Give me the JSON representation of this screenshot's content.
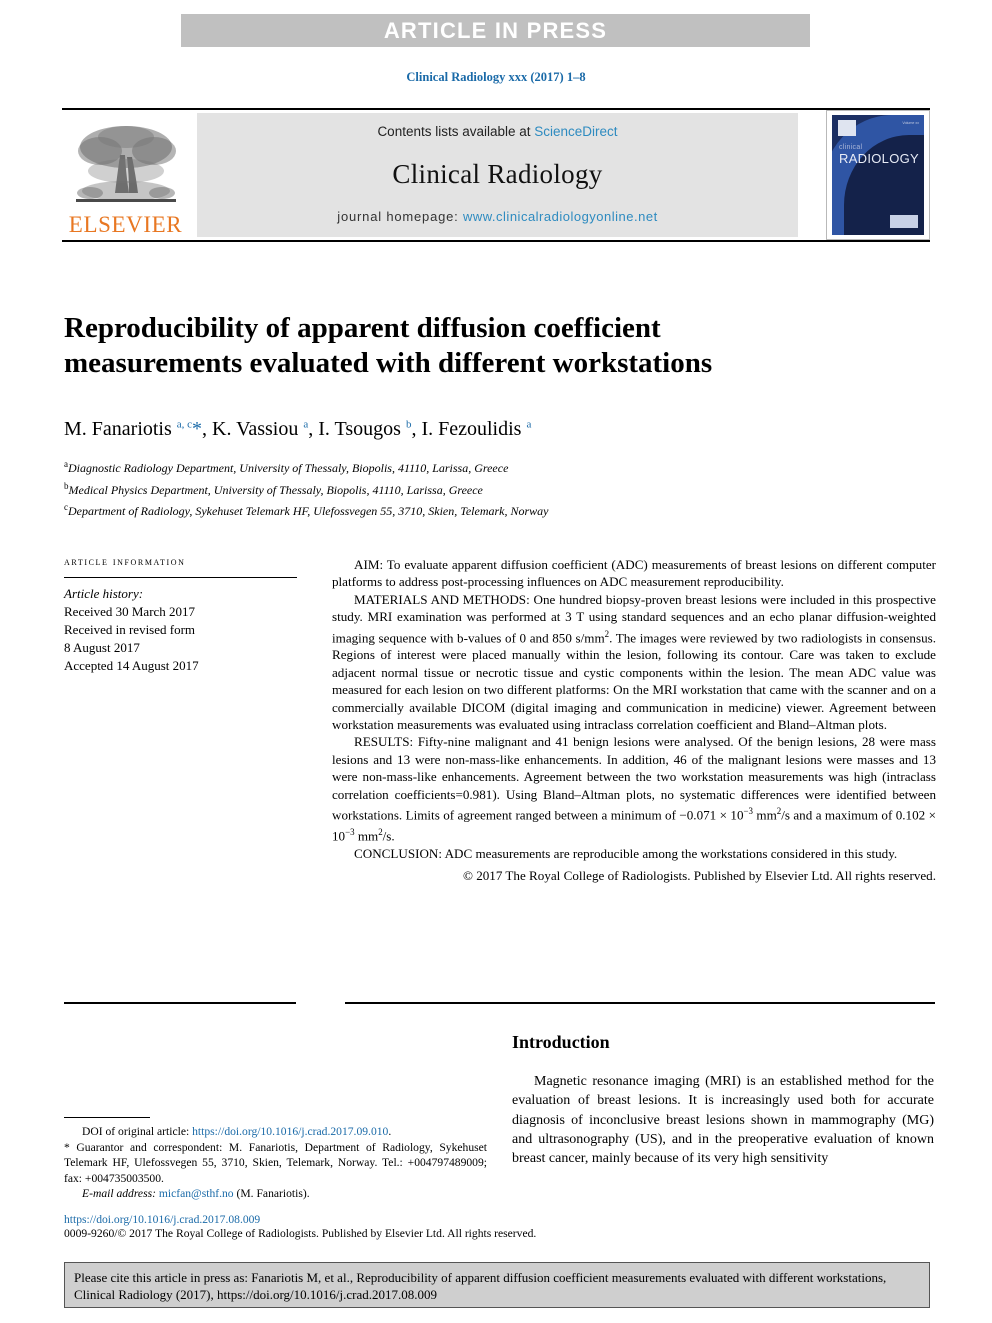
{
  "banner": {
    "text": "ARTICLE IN PRESS"
  },
  "journal_line": "Clinical Radiology xxx (2017) 1–8",
  "masthead": {
    "elsevier_wordmark": "ELSEVIER",
    "contents_prefix": "Contents lists available at ",
    "contents_link": "ScienceDirect",
    "journal_title": "Clinical Radiology",
    "homepage_prefix": "journal homepage: ",
    "homepage_link": "www.clinicalradiologyonline.net",
    "cover": {
      "line1": "clinical",
      "line2": "RADIOLOGY",
      "corner_text": "Volume xx"
    }
  },
  "article": {
    "title": "Reproducibility of apparent diffusion coefficient measurements evaluated with different workstations",
    "authors_html": "M. Fanariotis <sup>a, c</sup><span class=\"star\">*</span>, K. Vassiou <sup>a</sup>, I. Tsougos <sup>b</sup>, I. Fezoulidis <sup>a</sup>",
    "affiliations": [
      {
        "marker": "a",
        "text": "Diagnostic Radiology Department, University of Thessaly, Biopolis, 41110, Larissa, Greece"
      },
      {
        "marker": "b",
        "text": "Medical Physics Department, University of Thessaly, Biopolis, 41110, Larissa, Greece"
      },
      {
        "marker": "c",
        "text": "Department of Radiology, Sykehuset Telemark HF, Ulefossvegen 55, 3710, Skien, Telemark, Norway"
      }
    ]
  },
  "article_info": {
    "heading": "ARTICLE INFORMATION",
    "history_label": "Article history:",
    "history": [
      "Received 30 March 2017",
      "Received in revised form",
      "8 August 2017",
      "Accepted 14 August 2017"
    ]
  },
  "abstract": {
    "aim": "AIM: To evaluate apparent diffusion coefficient (ADC) measurements of breast lesions on different computer platforms to address post-processing influences on ADC measurement reproducibility.",
    "materials_html": "MATERIALS AND METHODS: One hundred biopsy-proven breast lesions were included in this prospective study. MRI examination was performed at 3 T using standard sequences and an echo planar diffusion-weighted imaging sequence with b-values of 0 and 850 s/mm<sup class=\"sup-s\">2</sup>. The images were reviewed by two radiologists in consensus. Regions of interest were placed manually within the lesion, following its contour. Care was taken to exclude adjacent normal tissue or necrotic tissue and cystic components within the lesion. The mean ADC value was measured for each lesion on two different platforms: On the MRI workstation that came with the scanner and on a commercially available DICOM (digital imaging and communication in medicine) viewer. Agreement between workstation measurements was evaluated using intraclass correlation coefficient and Bland–Altman plots.",
    "results_html": "RESULTS: Fifty-nine malignant and 41 benign lesions were analysed. Of the benign lesions, 28 were mass lesions and 13 were non-mass-like enhancements. In addition, 46 of the malignant lesions were masses and 13 were non-mass-like enhancements. Agreement between the two workstation measurements was high (intraclass correlation coefficients=0.981). Using Bland–Altman plots, no systematic differences were identified between workstations. Limits of agreement ranged between a minimum of −0.071 × 10<sup class=\"sup-s\">−3</sup> mm<sup class=\"sup-s\">2</sup>/s and a maximum of 0.102 × 10<sup class=\"sup-s\">−3</sup> mm<sup class=\"sup-s\">2</sup>/s.",
    "conclusion": "CONCLUSION: ADC measurements are reproducible among the workstations considered in this study.",
    "copyright": "© 2017 The Royal College of Radiologists. Published by Elsevier Ltd. All rights reserved."
  },
  "introduction": {
    "heading": "Introduction",
    "paragraph": "Magnetic resonance imaging (MRI) is an established method for the evaluation of breast lesions. It is increasingly used both for accurate diagnosis of inconclusive breast lesions shown in mammography (MG) and ultrasonography (US), and in the preoperative evaluation of known breast cancer, mainly because of its very high sensitivity"
  },
  "footnotes": {
    "doi_original_label": "DOI of original article: ",
    "doi_original_link": "https://doi.org/10.1016/j.crad.2017.09.010",
    "doi_original_suffix": ".",
    "correspondent": "* Guarantor and correspondent: M. Fanariotis, Department of Radiology, Sykehuset Telemark HF, Ulefossvegen 55, 3710, Skien, Telemark, Norway. Tel.: +004797489009; fax: +004735003500.",
    "email_label": "E-mail address: ",
    "email_link": "micfan@sthf.no",
    "email_suffix": " (M. Fanariotis).",
    "doi_line": "https://doi.org/10.1016/j.crad.2017.08.009",
    "issn_line": "0009-9260/© 2017 The Royal College of Radiologists. Published by Elsevier Ltd. All rights reserved."
  },
  "citation_box": {
    "text": "Please cite this article in press as: Fanariotis M, et al., Reproducibility of apparent diffusion coefficient measurements evaluated with different workstations, Clinical Radiology (2017), https://doi.org/10.1016/j.crad.2017.08.009"
  },
  "colors": {
    "banner_bg": "#c0c0c0",
    "link_blue": "#1a6aa8",
    "sciencedirect_blue": "#2e8bc0",
    "elsevier_orange": "#E87722",
    "panel_grey": "#e3e3e3",
    "cite_box_grey": "#cfcfcf",
    "cover_blue": "#1c2f63"
  }
}
